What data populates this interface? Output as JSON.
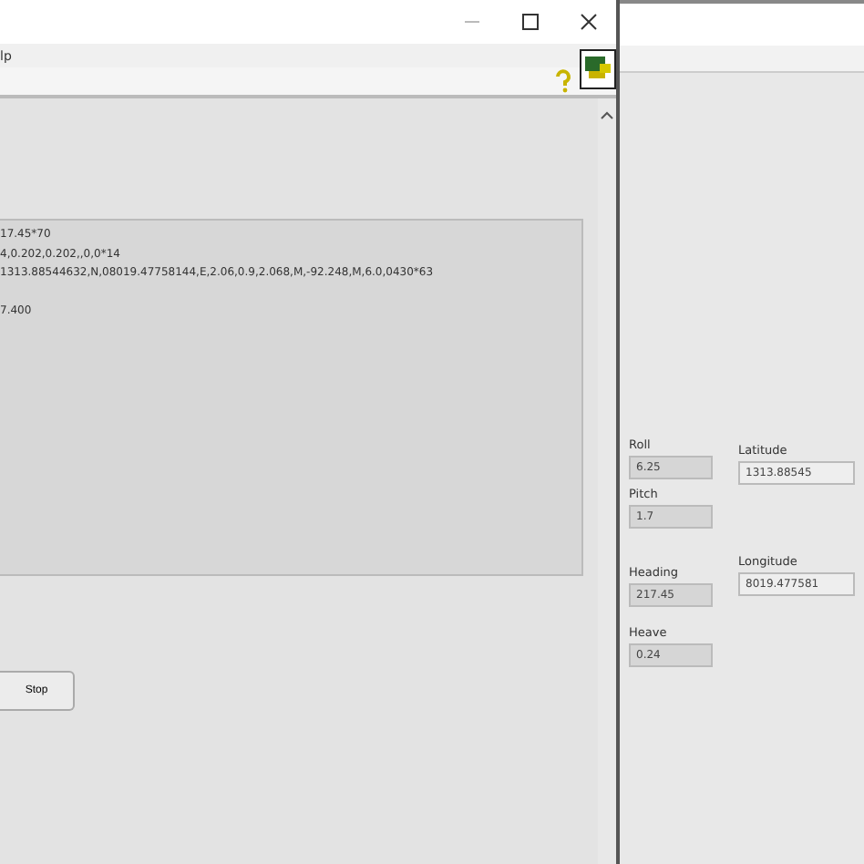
{
  "left_window": {
    "menu_text": "lp",
    "output_blocks": [
      [
        "17.45*70",
        "4,0.202,0.202,,0,0*14",
        "1313.88544632,N,08019.47758144,E,2.06,0.9,2.068,M,-92.248,M,6.0,0430*63"
      ],
      [
        "7.400"
      ]
    ],
    "stop_button": "Stop"
  },
  "right_window": {
    "fields": [
      {
        "label": "Roll",
        "value": "6.25"
      },
      {
        "label": "Pitch",
        "value": "1.7"
      },
      {
        "label": "Heading",
        "value": "217.45"
      },
      {
        "label": "Heave",
        "value": "0.24"
      }
    ],
    "position": [
      {
        "label": "Latitude",
        "value": "1313.88545"
      },
      {
        "label": "Longitude",
        "value": "8019.477581"
      }
    ]
  }
}
